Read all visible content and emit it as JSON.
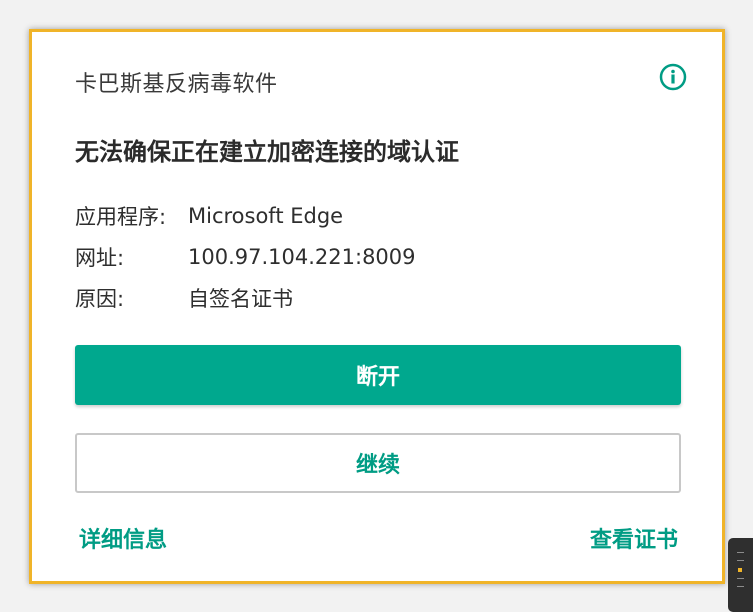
{
  "dialog": {
    "app_title": "卡巴斯基反病毒软件",
    "headline": "无法确保正在建立加密连接的域认证",
    "details": [
      {
        "label": "应用程序:",
        "value": "Microsoft Edge"
      },
      {
        "label": "网址:",
        "value": "100.97.104.221:8009"
      },
      {
        "label": "原因:",
        "value": "自签名证书"
      }
    ],
    "primary_button": "断开",
    "secondary_button": "继续",
    "link_details": "详细信息",
    "link_view_certificate": "查看证书",
    "info_icon": "info-circle-icon"
  },
  "colors": {
    "accent": "#00a88e",
    "link": "#009c84",
    "border": "#f0b429"
  }
}
